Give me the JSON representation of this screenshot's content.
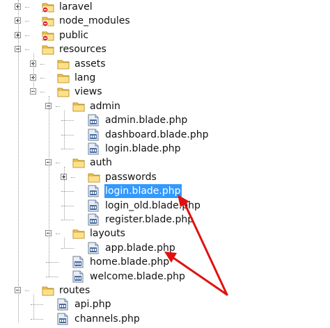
{
  "tree": [
    {
      "name": "laravel",
      "type": "folder",
      "depth": 0,
      "expander": "plus",
      "badge": true
    },
    {
      "name": "node_modules",
      "type": "folder",
      "depth": 0,
      "expander": "plus",
      "badge": true
    },
    {
      "name": "public",
      "type": "folder",
      "depth": 0,
      "expander": "plus",
      "badge": true
    },
    {
      "name": "resources",
      "type": "folder",
      "depth": 0,
      "expander": "minus"
    },
    {
      "name": "assets",
      "type": "folder",
      "depth": 1,
      "expander": "plus"
    },
    {
      "name": "lang",
      "type": "folder",
      "depth": 1,
      "expander": "plus"
    },
    {
      "name": "views",
      "type": "folder",
      "depth": 1,
      "expander": "minus"
    },
    {
      "name": "admin",
      "type": "folder",
      "depth": 2,
      "expander": "minus"
    },
    {
      "name": "admin.blade.php",
      "type": "file",
      "depth": 3
    },
    {
      "name": "dashboard.blade.php",
      "type": "file",
      "depth": 3
    },
    {
      "name": "login.blade.php",
      "type": "file",
      "depth": 3
    },
    {
      "name": "auth",
      "type": "folder",
      "depth": 2,
      "expander": "minus"
    },
    {
      "name": "passwords",
      "type": "folder",
      "depth": 3,
      "expander": "plus"
    },
    {
      "name": "login.blade.php",
      "type": "file",
      "depth": 3,
      "selected": true
    },
    {
      "name": "login_old.blade.php",
      "type": "file",
      "depth": 3
    },
    {
      "name": "register.blade.php",
      "type": "file",
      "depth": 3
    },
    {
      "name": "layouts",
      "type": "folder",
      "depth": 2,
      "expander": "minus"
    },
    {
      "name": "app.blade.php",
      "type": "file",
      "depth": 3
    },
    {
      "name": "home.blade.php",
      "type": "file",
      "depth": 2
    },
    {
      "name": "welcome.blade.php",
      "type": "file",
      "depth": 2
    },
    {
      "name": "routes",
      "type": "folder",
      "depth": 0,
      "expander": "minus"
    },
    {
      "name": "api.php",
      "type": "file",
      "depth": 1
    },
    {
      "name": "channels.php",
      "type": "file",
      "depth": 1
    }
  ],
  "colors": {
    "selection": "#3399ff",
    "folder": "#f2c94c",
    "annotation_arrow": "#e01010",
    "badge": "#d9232e"
  },
  "icons": {
    "folder": "folder-icon",
    "file": "php-file-icon",
    "expand": "plus-box-icon",
    "collapse": "minus-box-icon",
    "badge": "red-status-badge-icon"
  }
}
